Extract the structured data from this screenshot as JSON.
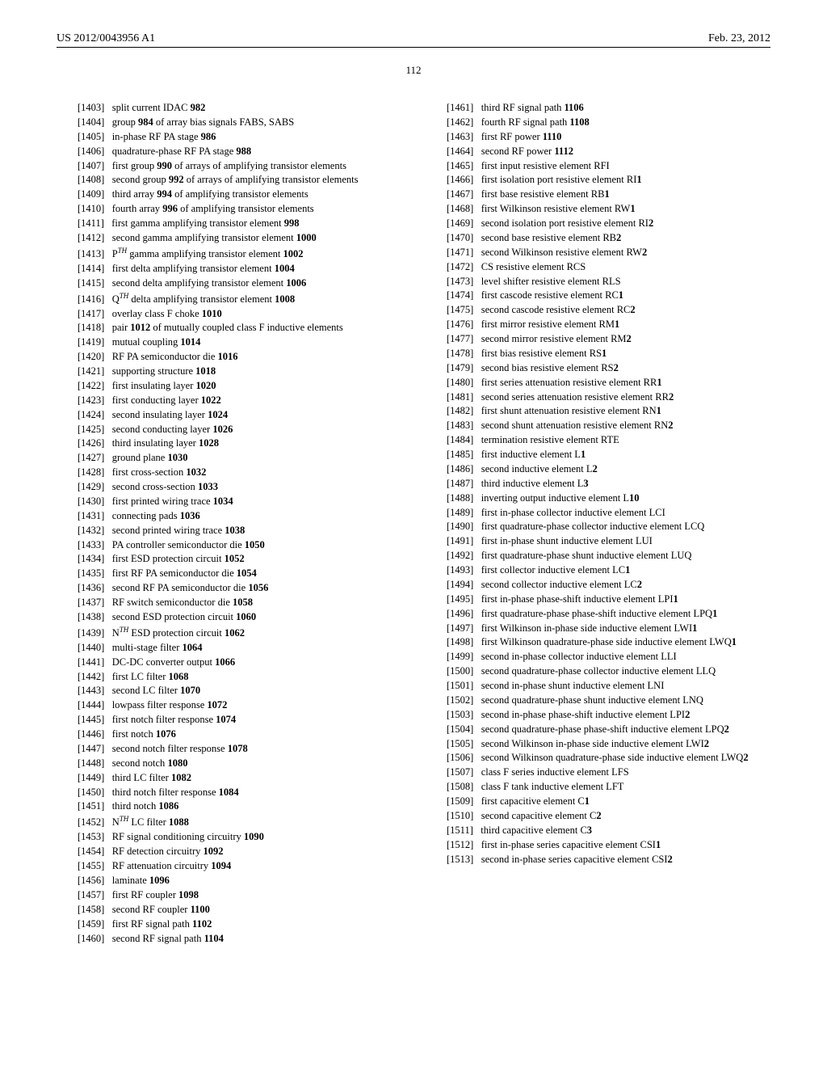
{
  "header": {
    "pubnum": "US 2012/0043956 A1",
    "date": "Feb. 23, 2012"
  },
  "page_number": "112",
  "left": [
    {
      "n": "1403",
      "t": "split current IDAC ",
      "b": "982"
    },
    {
      "n": "1404",
      "t": "group ",
      "b": "984",
      "t2": " of array bias signals FABS, SABS"
    },
    {
      "n": "1405",
      "t": "in-phase RF PA stage ",
      "b": "986"
    },
    {
      "n": "1406",
      "t": "quadrature-phase RF PA stage ",
      "b": "988"
    },
    {
      "n": "1407",
      "t": "first group ",
      "b": "990",
      "t2": " of arrays of amplifying transistor elements"
    },
    {
      "n": "1408",
      "t": "second group ",
      "b": "992",
      "t2": " of arrays of amplifying transistor elements"
    },
    {
      "n": "1409",
      "t": "third array ",
      "b": "994",
      "t2": " of amplifying transistor elements"
    },
    {
      "n": "1410",
      "t": "fourth array ",
      "b": "996",
      "t2": " of amplifying transistor elements"
    },
    {
      "n": "1411",
      "t": "first gamma amplifying transistor element ",
      "b": "998"
    },
    {
      "n": "1412",
      "t": "second gamma amplifying transistor element ",
      "b": "1000"
    },
    {
      "n": "1413",
      "pre": "P",
      "sup": "TH",
      "t": " gamma amplifying transistor element ",
      "b": "1002"
    },
    {
      "n": "1414",
      "t": "first delta amplifying transistor element ",
      "b": "1004"
    },
    {
      "n": "1415",
      "t": "second delta amplifying transistor element ",
      "b": "1006"
    },
    {
      "n": "1416",
      "pre": "Q",
      "sup": "TH",
      "t": " delta amplifying transistor element ",
      "b": "1008"
    },
    {
      "n": "1417",
      "t": "overlay class F choke ",
      "b": "1010"
    },
    {
      "n": "1418",
      "t": "pair ",
      "b": "1012",
      "t2": " of mutually coupled class F inductive elements"
    },
    {
      "n": "1419",
      "t": "mutual coupling ",
      "b": "1014"
    },
    {
      "n": "1420",
      "t": "RF PA semiconductor die ",
      "b": "1016"
    },
    {
      "n": "1421",
      "t": "supporting structure ",
      "b": "1018"
    },
    {
      "n": "1422",
      "t": "first insulating layer ",
      "b": "1020"
    },
    {
      "n": "1423",
      "t": "first conducting layer ",
      "b": "1022"
    },
    {
      "n": "1424",
      "t": "second insulating layer ",
      "b": "1024"
    },
    {
      "n": "1425",
      "t": "second conducting layer ",
      "b": "1026"
    },
    {
      "n": "1426",
      "t": "third insulating layer ",
      "b": "1028"
    },
    {
      "n": "1427",
      "t": "ground plane ",
      "b": "1030"
    },
    {
      "n": "1428",
      "t": "first cross-section ",
      "b": "1032"
    },
    {
      "n": "1429",
      "t": "second cross-section ",
      "b": "1033"
    },
    {
      "n": "1430",
      "t": "first printed wiring trace ",
      "b": "1034"
    },
    {
      "n": "1431",
      "t": "connecting pads ",
      "b": "1036"
    },
    {
      "n": "1432",
      "t": "second printed wiring trace ",
      "b": "1038"
    },
    {
      "n": "1433",
      "t": "PA controller semiconductor die ",
      "b": "1050"
    },
    {
      "n": "1434",
      "t": "first ESD protection circuit ",
      "b": "1052"
    },
    {
      "n": "1435",
      "t": "first RF PA semiconductor die ",
      "b": "1054"
    },
    {
      "n": "1436",
      "t": "second RF PA semiconductor die ",
      "b": "1056"
    },
    {
      "n": "1437",
      "t": "RF switch semiconductor die ",
      "b": "1058"
    },
    {
      "n": "1438",
      "t": "second ESD protection circuit ",
      "b": "1060"
    },
    {
      "n": "1439",
      "pre": "N",
      "sup": "TH",
      "t": " ESD protection circuit ",
      "b": "1062"
    },
    {
      "n": "1440",
      "t": "multi-stage filter ",
      "b": "1064"
    },
    {
      "n": "1441",
      "t": "DC-DC converter output ",
      "b": "1066"
    },
    {
      "n": "1442",
      "t": "first LC filter ",
      "b": "1068"
    },
    {
      "n": "1443",
      "t": "second LC filter ",
      "b": "1070"
    },
    {
      "n": "1444",
      "t": "lowpass filter response ",
      "b": "1072"
    },
    {
      "n": "1445",
      "t": "first notch filter response ",
      "b": "1074"
    },
    {
      "n": "1446",
      "t": "first notch ",
      "b": "1076"
    },
    {
      "n": "1447",
      "t": "second notch filter response ",
      "b": "1078"
    },
    {
      "n": "1448",
      "t": "second notch ",
      "b": "1080"
    },
    {
      "n": "1449",
      "t": "third LC filter ",
      "b": "1082"
    },
    {
      "n": "1450",
      "t": "third notch filter response ",
      "b": "1084"
    },
    {
      "n": "1451",
      "t": "third notch ",
      "b": "1086"
    },
    {
      "n": "1452",
      "pre": "N",
      "sup": "TH",
      "t": " LC filter ",
      "b": "1088"
    },
    {
      "n": "1453",
      "t": "RF signal conditioning circuitry ",
      "b": "1090"
    },
    {
      "n": "1454",
      "t": "RF detection circuitry ",
      "b": "1092"
    },
    {
      "n": "1455",
      "t": "RF attenuation circuitry ",
      "b": "1094"
    },
    {
      "n": "1456",
      "t": "laminate ",
      "b": "1096"
    },
    {
      "n": "1457",
      "t": "first RF coupler ",
      "b": "1098"
    },
    {
      "n": "1458",
      "t": "second RF coupler ",
      "b": "1100"
    },
    {
      "n": "1459",
      "t": "first RF signal path ",
      "b": "1102"
    },
    {
      "n": "1460",
      "t": "second RF signal path ",
      "b": "1104"
    }
  ],
  "right": [
    {
      "n": "1461",
      "t": "third RF signal path ",
      "b": "1106"
    },
    {
      "n": "1462",
      "t": "fourth RF signal path ",
      "b": "1108"
    },
    {
      "n": "1463",
      "t": "first RF power ",
      "b": "1110"
    },
    {
      "n": "1464",
      "t": "second RF power ",
      "b": "1112"
    },
    {
      "n": "1465",
      "t": "first input resistive element RFI"
    },
    {
      "n": "1466",
      "t": "first isolation port resistive element RI",
      "b": "1"
    },
    {
      "n": "1467",
      "t": "first base resistive element RB",
      "b": "1"
    },
    {
      "n": "1468",
      "t": "first Wilkinson resistive element RW",
      "b": "1"
    },
    {
      "n": "1469",
      "t": "second isolation port resistive element RI",
      "b": "2"
    },
    {
      "n": "1470",
      "t": "second base resistive element RB",
      "b": "2"
    },
    {
      "n": "1471",
      "t": "second Wilkinson resistive element RW",
      "b": "2"
    },
    {
      "n": "1472",
      "t": "CS resistive element RCS"
    },
    {
      "n": "1473",
      "t": "level shifter resistive element RLS"
    },
    {
      "n": "1474",
      "t": "first cascode resistive element RC",
      "b": "1"
    },
    {
      "n": "1475",
      "t": "second cascode resistive element RC",
      "b": "2"
    },
    {
      "n": "1476",
      "t": "first mirror resistive element RM",
      "b": "1"
    },
    {
      "n": "1477",
      "t": "second mirror resistive element RM",
      "b": "2"
    },
    {
      "n": "1478",
      "t": "first bias resistive element RS",
      "b": "1"
    },
    {
      "n": "1479",
      "t": "second bias resistive element RS",
      "b": "2"
    },
    {
      "n": "1480",
      "t": "first series attenuation resistive element RR",
      "b": "1"
    },
    {
      "n": "1481",
      "t": "second series attenuation resistive element RR",
      "b": "2"
    },
    {
      "n": "1482",
      "t": "first shunt attenuation resistive element RN",
      "b": "1"
    },
    {
      "n": "1483",
      "t": "second shunt attenuation resistive element RN",
      "b": "2"
    },
    {
      "n": "1484",
      "t": "termination resistive element RTE"
    },
    {
      "n": "1485",
      "t": "first inductive element L",
      "b": "1"
    },
    {
      "n": "1486",
      "t": "second inductive element L",
      "b": "2"
    },
    {
      "n": "1487",
      "t": "third inductive element L",
      "b": "3"
    },
    {
      "n": "1488",
      "t": "inverting output inductive element L",
      "b": "10"
    },
    {
      "n": "1489",
      "t": "first in-phase collector inductive element LCI"
    },
    {
      "n": "1490",
      "t": "first quadrature-phase collector inductive element LCQ"
    },
    {
      "n": "1491",
      "t": "first in-phase shunt inductive element LUI"
    },
    {
      "n": "1492",
      "t": "first quadrature-phase shunt inductive element LUQ"
    },
    {
      "n": "1493",
      "t": "first collector inductive element LC",
      "b": "1"
    },
    {
      "n": "1494",
      "t": "second collector inductive element LC",
      "b": "2"
    },
    {
      "n": "1495",
      "t": "first in-phase phase-shift inductive element LPI",
      "b": "1"
    },
    {
      "n": "1496",
      "t": "first quadrature-phase phase-shift inductive element LPQ",
      "b": "1"
    },
    {
      "n": "1497",
      "t": "first Wilkinson in-phase side inductive element LWI",
      "b": "1"
    },
    {
      "n": "1498",
      "t": "first Wilkinson quadrature-phase side inductive element LWQ",
      "b": "1"
    },
    {
      "n": "1499",
      "t": "second in-phase collector inductive element LLI"
    },
    {
      "n": "1500",
      "t": "second quadrature-phase collector inductive element LLQ"
    },
    {
      "n": "1501",
      "t": "second in-phase shunt inductive element LNI"
    },
    {
      "n": "1502",
      "t": "second quadrature-phase shunt inductive element LNQ"
    },
    {
      "n": "1503",
      "t": "second in-phase phase-shift inductive element LPI",
      "b": "2"
    },
    {
      "n": "1504",
      "t": "second quadrature-phase phase-shift inductive element LPQ",
      "b": "2"
    },
    {
      "n": "1505",
      "t": "second Wilkinson in-phase side inductive element LWI",
      "b": "2"
    },
    {
      "n": "1506",
      "t": "second Wilkinson quadrature-phase side inductive element LWQ",
      "b": "2"
    },
    {
      "n": "1507",
      "t": "class F series inductive element LFS"
    },
    {
      "n": "1508",
      "t": "class F tank inductive element LFT"
    },
    {
      "n": "1509",
      "t": "first capacitive element C",
      "b": "1"
    },
    {
      "n": "1510",
      "t": "second capacitive element C",
      "b": "2"
    },
    {
      "n": "1511",
      "t": "third capacitive element C",
      "b": "3"
    },
    {
      "n": "1512",
      "t": "first in-phase series capacitive element CSI",
      "b": "1"
    },
    {
      "n": "1513",
      "t": "second in-phase series capacitive element CSI",
      "b": "2"
    }
  ]
}
